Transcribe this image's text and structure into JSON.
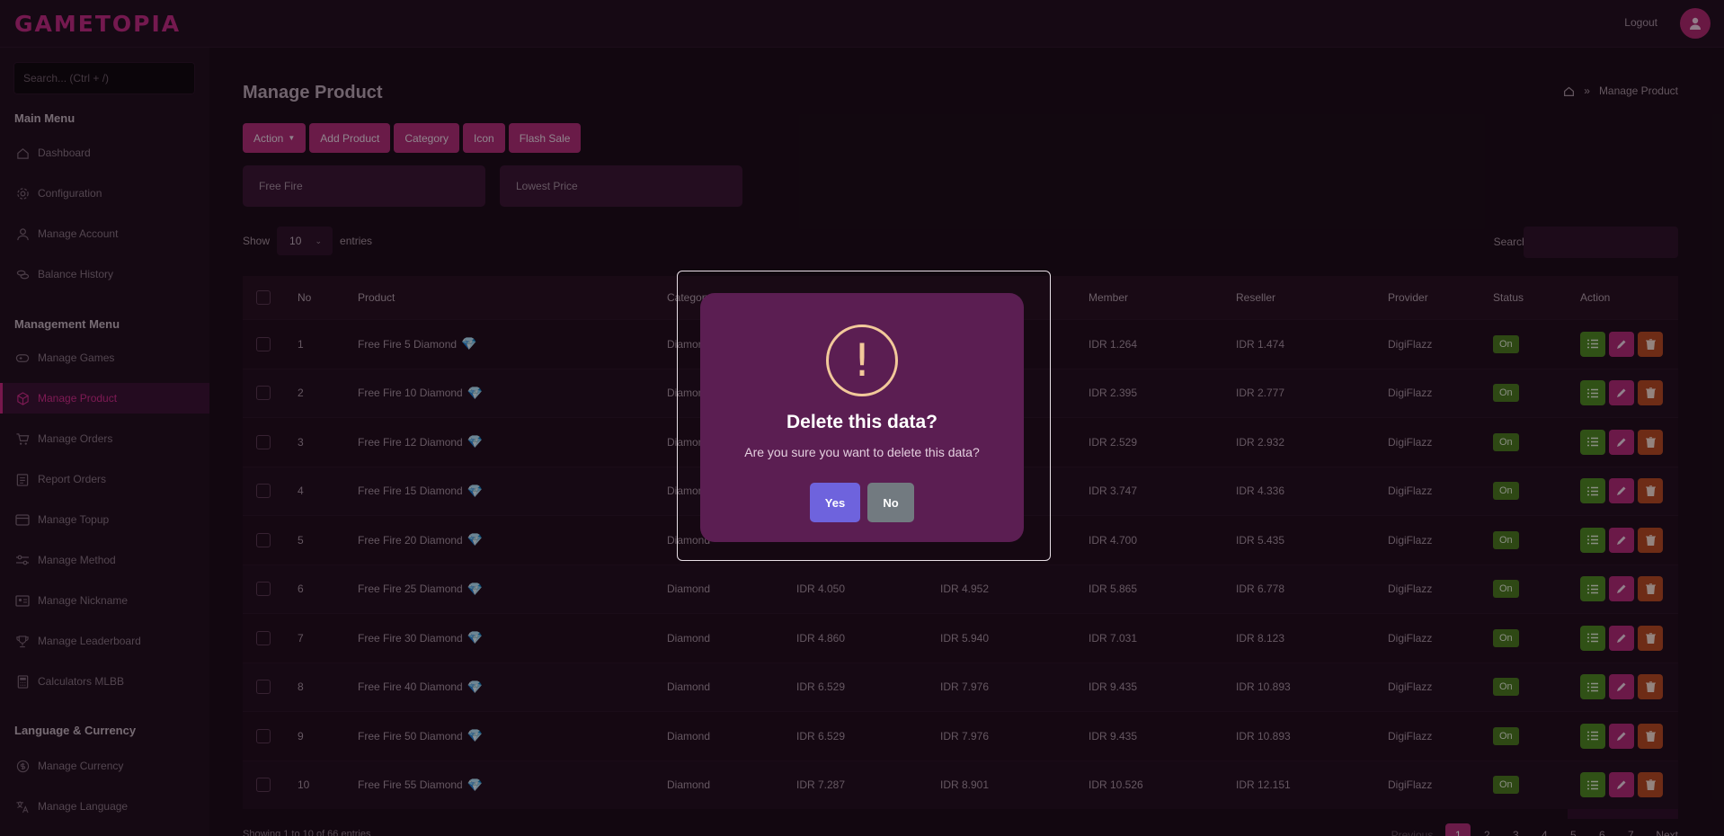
{
  "app": {
    "logo": "GAMETOPIA",
    "logout_label": "Logout"
  },
  "sidebar": {
    "search_placeholder": "Search... (Ctrl + /)",
    "sections": [
      {
        "title": "Main Menu"
      },
      {
        "title": "Management Menu"
      },
      {
        "title": "Language & Currency"
      }
    ],
    "items": [
      {
        "label": "Dashboard",
        "icon": "home-icon"
      },
      {
        "label": "Configuration",
        "icon": "gear-icon"
      },
      {
        "label": "Manage Account",
        "icon": "user-icon"
      },
      {
        "label": "Balance History",
        "icon": "coins-icon"
      },
      {
        "label": "Manage Games",
        "icon": "gamepad-icon"
      },
      {
        "label": "Manage Product",
        "icon": "box-icon",
        "active": true
      },
      {
        "label": "Manage Orders",
        "icon": "cart-icon"
      },
      {
        "label": "Report Orders",
        "icon": "clipboard-icon"
      },
      {
        "label": "Manage Topup",
        "icon": "card-icon"
      },
      {
        "label": "Manage Method",
        "icon": "sliders-icon"
      },
      {
        "label": "Manage Nickname",
        "icon": "id-card-icon"
      },
      {
        "label": "Manage Leaderboard",
        "icon": "trophy-icon"
      },
      {
        "label": "Calculators MLBB",
        "icon": "calculator-icon"
      },
      {
        "label": "Manage Currency",
        "icon": "dollar-icon"
      },
      {
        "label": "Manage Language",
        "icon": "translate-icon"
      }
    ]
  },
  "main": {
    "title": "Manage Product",
    "breadcrumb": {
      "current": "Manage Product"
    },
    "buttons": {
      "action": "Action",
      "add_product": "Add Product",
      "category": "Category",
      "icon": "Icon",
      "flash_sale": "Flash Sale"
    },
    "filters": {
      "game": "Free Fire",
      "sort": "Lowest Price"
    },
    "show_label": "Show",
    "entries_value": "10",
    "entries_label": "entries",
    "search_label": "Search:",
    "footer_info": "Showing 1 to 10 of 66 entries",
    "pager": {
      "prev": "Previous",
      "next": "Next",
      "pages": [
        "1",
        "2",
        "3",
        "4",
        "5",
        "6",
        "7"
      ]
    }
  },
  "table": {
    "headers": {
      "no": "No",
      "product": "Product",
      "category": "Category",
      "member": "Member",
      "reseller": "Reseller",
      "provider": "Provider",
      "status": "Status",
      "action": "Action"
    },
    "rows": [
      {
        "no": "1",
        "product": "Free Fire 5 Diamond",
        "category": "Diamond",
        "price1": "",
        "price2": "",
        "member": "IDR 1.264",
        "reseller": "IDR 1.474",
        "provider": "DigiFlazz",
        "status": "On"
      },
      {
        "no": "2",
        "product": "Free Fire 10 Diamond",
        "category": "Diamond",
        "price1": "",
        "price2": "",
        "member": "IDR 2.395",
        "reseller": "IDR 2.777",
        "provider": "DigiFlazz",
        "status": "On"
      },
      {
        "no": "3",
        "product": "Free Fire 12 Diamond",
        "category": "Diamond",
        "price1": "",
        "price2": "",
        "member": "IDR 2.529",
        "reseller": "IDR 2.932",
        "provider": "DigiFlazz",
        "status": "On"
      },
      {
        "no": "4",
        "product": "Free Fire 15 Diamond",
        "category": "Diamond",
        "price1": "",
        "price2": "",
        "member": "IDR 3.747",
        "reseller": "IDR 4.336",
        "provider": "DigiFlazz",
        "status": "On"
      },
      {
        "no": "5",
        "product": "Free Fire 20 Diamond",
        "category": "Diamond",
        "price1": "",
        "price2": "",
        "member": "IDR 4.700",
        "reseller": "IDR 5.435",
        "provider": "DigiFlazz",
        "status": "On"
      },
      {
        "no": "6",
        "product": "Free Fire 25 Diamond",
        "category": "Diamond",
        "price1": "IDR 4.050",
        "price2": "IDR 4.952",
        "member": "IDR 5.865",
        "reseller": "IDR 6.778",
        "provider": "DigiFlazz",
        "status": "On"
      },
      {
        "no": "7",
        "product": "Free Fire 30 Diamond",
        "category": "Diamond",
        "price1": "IDR 4.860",
        "price2": "IDR 5.940",
        "member": "IDR 7.031",
        "reseller": "IDR 8.123",
        "provider": "DigiFlazz",
        "status": "On"
      },
      {
        "no": "8",
        "product": "Free Fire 40 Diamond",
        "category": "Diamond",
        "price1": "IDR 6.529",
        "price2": "IDR 7.976",
        "member": "IDR 9.435",
        "reseller": "IDR 10.893",
        "provider": "DigiFlazz",
        "status": "On"
      },
      {
        "no": "9",
        "product": "Free Fire 50 Diamond",
        "category": "Diamond",
        "price1": "IDR 6.529",
        "price2": "IDR 7.976",
        "member": "IDR 9.435",
        "reseller": "IDR 10.893",
        "provider": "DigiFlazz",
        "status": "On"
      },
      {
        "no": "10",
        "product": "Free Fire 55 Diamond",
        "category": "Diamond",
        "price1": "IDR 7.287",
        "price2": "IDR 8.901",
        "member": "IDR 10.526",
        "reseller": "IDR 12.151",
        "provider": "DigiFlazz",
        "status": "On"
      }
    ]
  },
  "modal": {
    "title": "Delete this data?",
    "text": "Are you sure you want to delete this data?",
    "yes": "Yes",
    "no": "No"
  },
  "colors": {
    "accent": "#b12d77",
    "status_on": "#4a7a1e",
    "modal_bg": "#5b1e52",
    "confirm": "#6e63dd",
    "cancel": "#727a80"
  }
}
